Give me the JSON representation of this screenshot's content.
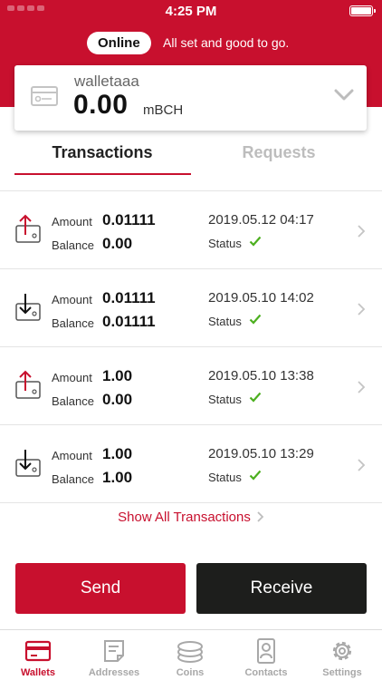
{
  "status_bar": {
    "time": "4:25 PM"
  },
  "header": {
    "online_badge": "Online",
    "online_message": "All set and good to go."
  },
  "wallet": {
    "name": "walletaaa",
    "amount": "0.00",
    "unit": "mBCH"
  },
  "tabs": [
    {
      "label": "Transactions",
      "active": true
    },
    {
      "label": "Requests",
      "active": false
    }
  ],
  "transactions": [
    {
      "direction": "sent",
      "amount_label": "Amount",
      "amount": "0.01111",
      "balance_label": "Balance",
      "balance": "0.00",
      "date": "2019.05.12",
      "time": "04:17",
      "status_label": "Status",
      "status": "confirmed"
    },
    {
      "direction": "received",
      "amount_label": "Amount",
      "amount": "0.01111",
      "balance_label": "Balance",
      "balance": "0.01111",
      "date": "2019.05.10",
      "time": "14:02",
      "status_label": "Status",
      "status": "confirmed"
    },
    {
      "direction": "sent",
      "amount_label": "Amount",
      "amount": "1.00",
      "balance_label": "Balance",
      "balance": "0.00",
      "date": "2019.05.10",
      "time": "13:38",
      "status_label": "Status",
      "status": "confirmed"
    },
    {
      "direction": "received",
      "amount_label": "Amount",
      "amount": "1.00",
      "balance_label": "Balance",
      "balance": "1.00",
      "date": "2019.05.10",
      "time": "13:29",
      "status_label": "Status",
      "status": "confirmed"
    }
  ],
  "show_all": "Show All Transactions",
  "actions": {
    "send": "Send",
    "receive": "Receive"
  },
  "tabbar": [
    {
      "label": "Wallets",
      "icon": "wallet-icon",
      "active": true
    },
    {
      "label": "Addresses",
      "icon": "addresses-icon",
      "active": false
    },
    {
      "label": "Coins",
      "icon": "coins-icon",
      "active": false
    },
    {
      "label": "Contacts",
      "icon": "contacts-icon",
      "active": false
    },
    {
      "label": "Settings",
      "icon": "settings-icon",
      "active": false
    }
  ],
  "colors": {
    "brand": "#c8102e",
    "dark_button": "#1d1e1c",
    "check": "#4caf1f",
    "inactive": "#a8a8a8"
  }
}
